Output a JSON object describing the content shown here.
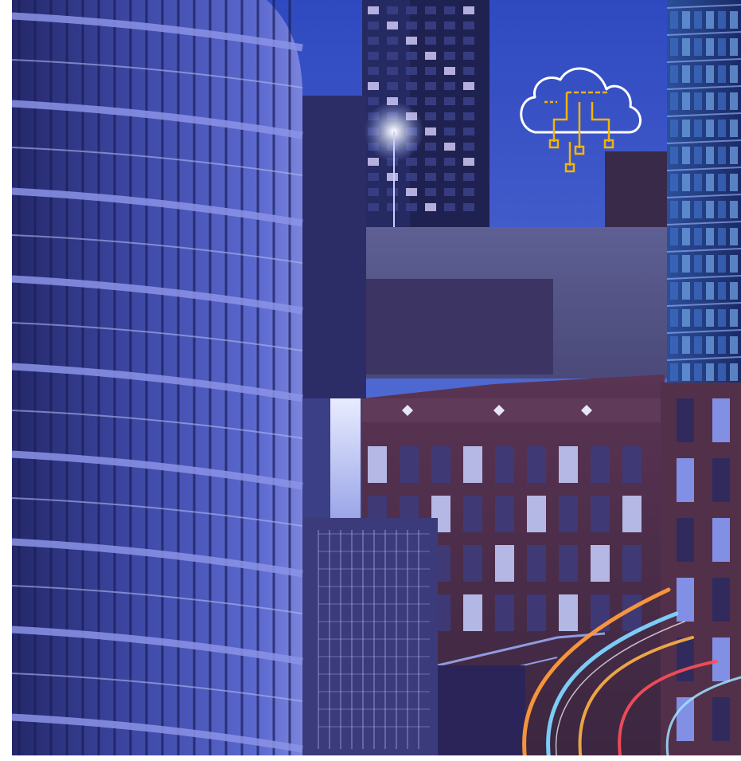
{
  "colors": {
    "sky_top": "#3b55c8",
    "sky_bottom": "#6a86e6",
    "glass_dark": "#1a1f55",
    "glass_light": "#5c6fd6",
    "glass_teal": "#2b7ea8",
    "brick": "#4e2f47",
    "brick_light": "#6a3e55",
    "concrete": "#5d5c8a",
    "cloud_icon_stroke": "#ffffff",
    "cloud_icon_accent": "#f5b400",
    "light_trail_orange": "#ff9a3c",
    "light_trail_blue": "#7fd6ff",
    "light_trail_red": "#ff4f5a"
  },
  "icons": {
    "overlay_icon": "cloud-computing-icon"
  }
}
